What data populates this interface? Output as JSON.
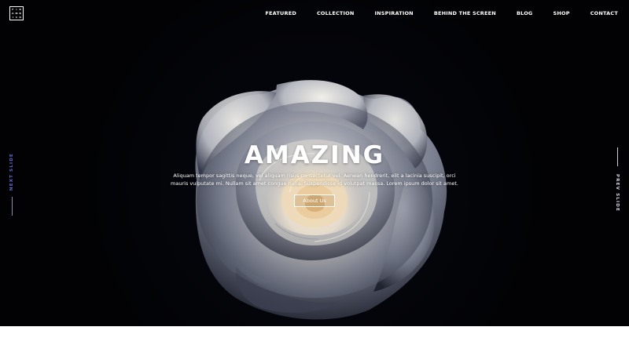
{
  "header": {
    "logo_letters": [
      "F",
      "I",
      "R",
      "A",
      "M",
      "B",
      "I",
      "C",
      "O"
    ],
    "nav": [
      {
        "label": "FEATURED"
      },
      {
        "label": "COLLECTION"
      },
      {
        "label": "INSPIRATION"
      },
      {
        "label": "BEHIND THE SCREEN"
      },
      {
        "label": "BLOG"
      },
      {
        "label": "SHOP"
      },
      {
        "label": "CONTACT"
      }
    ]
  },
  "hero": {
    "title": "AMAZING",
    "description": "Aliquam tempor sagittis neque, vel aliquam risus consectetur vel. Aenean hendrerit, elit a lacinia suscipit, orci mauris vulputate mi. Nullam sit amet congue nulla. Suspendisse id volutpat massa. Lorem ipsum dolor sit amet.",
    "button_label": "About Us",
    "next_slide_label": "NEXT SLIDE",
    "prev_slide_label": "PREV SLIDE"
  },
  "colors": {
    "background": "#04050a",
    "text": "#ffffff",
    "accent": "#5d6ec9"
  }
}
